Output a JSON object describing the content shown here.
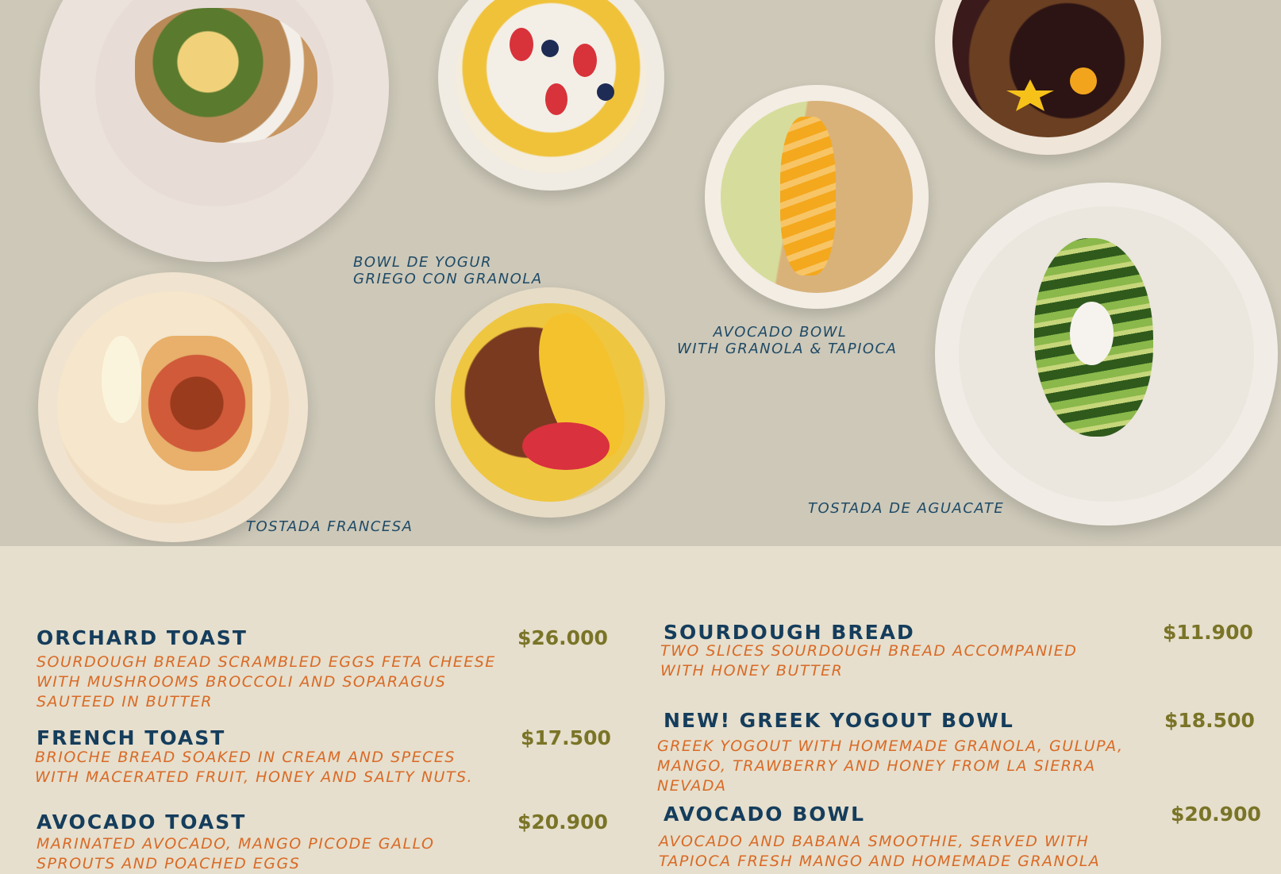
{
  "captions": {
    "greek_bowl": [
      "BOWL DE YOGUR",
      "GRIEGO CON GRANOLA"
    ],
    "avocado_bowl": [
      "AVOCADO BOWL",
      "WITH GRANOLA & TAPIOCA"
    ],
    "french_toast": "TOSTADA FRANCESA",
    "avocado_toast": "TOSTADA DE AGUACATE"
  },
  "menu_left": [
    {
      "name": "ORCHARD TOAST",
      "price": "$26.000",
      "description": "SOURDOUGH BREAD SCRAMBLED EGGS FETA CHEESE WITH MUSHROOMS BROCCOLI AND SOPARAGUS SAUTEED IN BUTTER"
    },
    {
      "name": "FRENCH TOAST",
      "price": "$17.500",
      "description": "BRIOCHE BREAD SOAKED IN CREAM AND SPECES WITH MACERATED FRUIT, HONEY AND SALTY NUTS."
    },
    {
      "name": "AVOCADO TOAST",
      "price": "$20.900",
      "description": "MARINATED AVOCADO, MANGO PICODE GALLO SPROUTS AND POACHED EGGS"
    }
  ],
  "menu_right": [
    {
      "name": "SOURDOUGH BREAD",
      "price": "$11.900",
      "description": "TWO SLICES SOURDOUGH BREAD ACCOMPANIED WITH HONEY BUTTER"
    },
    {
      "name": "NEW! GREEK YOGOUT BOWL",
      "price": "$18.500",
      "description": "GREEK YOGOUT WITH HOMEMADE GRANOLA, GULUPA, MANGO, TRAWBERRY AND HONEY FROM LA SIERRA NEVADA"
    },
    {
      "name": "AVOCADO BOWL",
      "price": "$20.900",
      "description": "AVOCADO AND BABANA SMOOTHIE, SERVED WITH TAPIOCA FRESH MANGO AND HOMEMADE GRANOLA"
    }
  ],
  "colors": {
    "photo_background": "#cdc8b8",
    "menu_background": "#e6dfcd",
    "item_name": "#153d5c",
    "item_price": "#7a7428",
    "item_description": "#d96a26",
    "caption": "#1f4a66"
  }
}
